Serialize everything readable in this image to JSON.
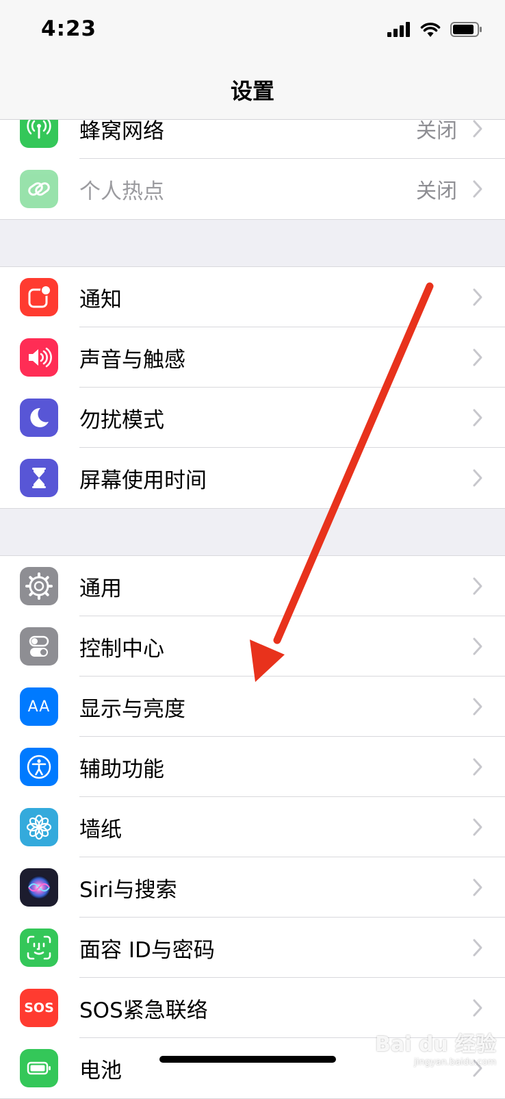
{
  "status": {
    "time": "4:23"
  },
  "nav": {
    "title": "设置"
  },
  "groups": [
    {
      "items": [
        {
          "label": "蜂窝网络",
          "value": "关闭",
          "icon": "antenna-icon",
          "color": "#34c759"
        },
        {
          "label": "个人热点",
          "value": "关闭",
          "icon": "link-icon",
          "color": "#34c759"
        }
      ]
    },
    {
      "items": [
        {
          "label": "通知",
          "icon": "notification-icon",
          "color": "#ff3b30"
        },
        {
          "label": "声音与触感",
          "icon": "speaker-icon",
          "color": "#ff2d55"
        },
        {
          "label": "勿扰模式",
          "icon": "moon-icon",
          "color": "#5856d6"
        },
        {
          "label": "屏幕使用时间",
          "icon": "hourglass-icon",
          "color": "#5856d6"
        }
      ]
    },
    {
      "items": [
        {
          "label": "通用",
          "icon": "gear-icon",
          "color": "#8e8e93"
        },
        {
          "label": "控制中心",
          "icon": "toggles-icon",
          "color": "#8e8e93"
        },
        {
          "label": "显示与亮度",
          "icon": "text-size-icon",
          "color": "#007aff"
        },
        {
          "label": "辅助功能",
          "icon": "accessibility-icon",
          "color": "#007aff"
        },
        {
          "label": "墙纸",
          "icon": "flower-icon",
          "color": "#34aadc"
        },
        {
          "label": "Siri与搜索",
          "icon": "siri-icon",
          "color": "#1c1c2e"
        },
        {
          "label": "面容 ID与密码",
          "icon": "face-id-icon",
          "color": "#34c759"
        },
        {
          "label": "SOS紧急联络",
          "icon": "sos-icon",
          "color": "#ff3b30"
        },
        {
          "label": "电池",
          "icon": "battery-icon",
          "color": "#34c759"
        }
      ]
    }
  ],
  "icon_text": {
    "text_size": "AA",
    "sos": "SOS"
  },
  "watermark": {
    "text": "Bai du 经验",
    "url": "jingyan.baidu.com"
  },
  "colors": {
    "arrow": "#e8321c",
    "separator": "#d8d8dc",
    "background": "#efeff4"
  }
}
